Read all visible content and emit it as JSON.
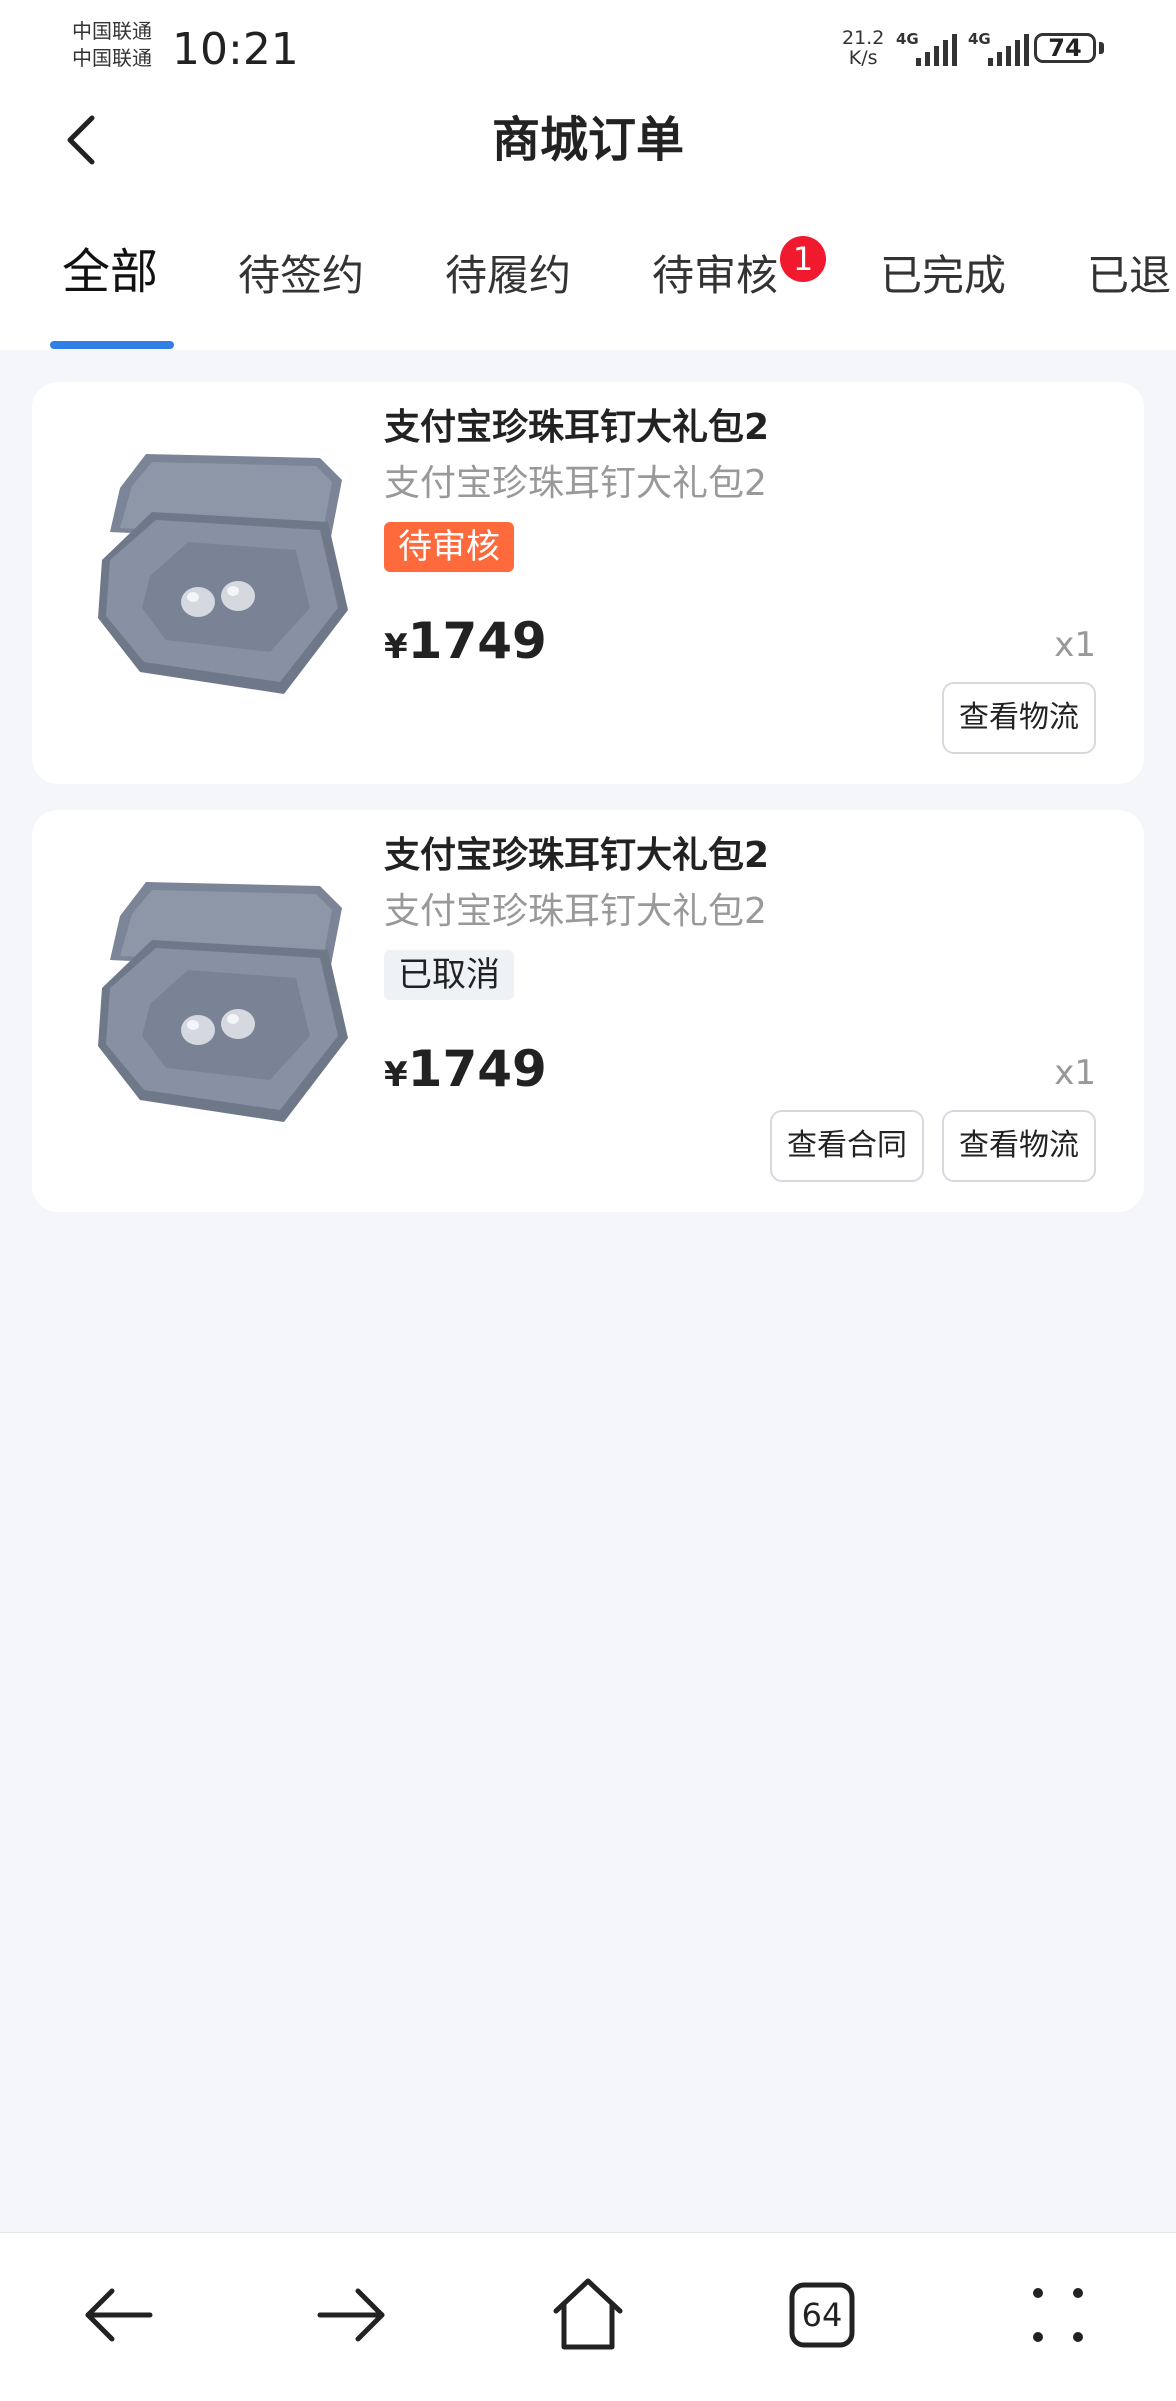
{
  "status_bar": {
    "carrier1": "中国联通",
    "carrier2": "中国联通",
    "time": "10:21",
    "net_speed_value": "21.2",
    "net_speed_unit": "K/s",
    "signal1_label": "4G",
    "signal2_label": "4G",
    "battery": "74"
  },
  "header": {
    "title": "商城订单",
    "back_icon": "chevron-left-icon"
  },
  "tabs": [
    {
      "label": "全部",
      "active": true
    },
    {
      "label": "待签约"
    },
    {
      "label": "待履约"
    },
    {
      "label": "待审核",
      "badge": "1"
    },
    {
      "label": "已完成"
    },
    {
      "label": "已退"
    }
  ],
  "orders": [
    {
      "name": "支付宝珍珠耳钉大礼包2",
      "subtitle": "支付宝珍珠耳钉大礼包2",
      "status": "待审核",
      "currency": "¥",
      "price": "1749",
      "qty": "x1",
      "actions": [
        "查看物流"
      ]
    },
    {
      "name": "支付宝珍珠耳钉大礼包2",
      "subtitle": "支付宝珍珠耳钉大礼包2",
      "status": "已取消",
      "currency": "¥",
      "price": "1749",
      "qty": "x1",
      "actions": [
        "查看合同",
        "查看物流"
      ]
    }
  ],
  "bottom_bar": {
    "back_icon": "arrow-left-icon",
    "forward_icon": "arrow-right-icon",
    "home_icon": "home-icon",
    "tabs_count": "64",
    "menu_icon": "more-dots-icon"
  },
  "colors": {
    "accent": "#2f7fe6",
    "badge": "#f0192d",
    "pending_tag": "#ff6a3d",
    "background": "#f4f6fb"
  }
}
